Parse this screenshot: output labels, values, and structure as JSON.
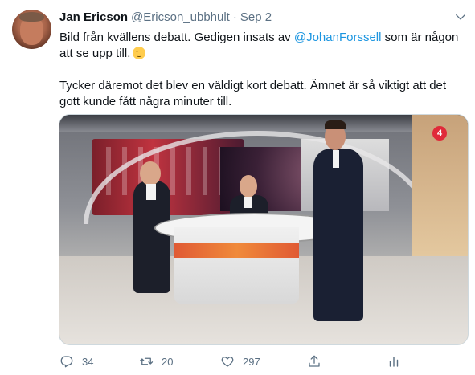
{
  "tweet": {
    "name": "Jan Ericson",
    "handle": "@Ericson_ubbhult",
    "separator": "·",
    "date": "Sep 2",
    "text": {
      "p1_before": "Bild från kvällens debatt. Gedigen insats av ",
      "mention": "@JohanForssell",
      "p1_after": " som är någon att se upp till.",
      "emoji": "winking-face-emoji",
      "p2": "Tycker däremot det blev en väldigt kort debatt. Ämnet är så viktigt att det gott kunde fått några minuter till."
    },
    "media": {
      "channel_logo": "4"
    },
    "actions": {
      "reply_count": "34",
      "retweet_count": "20",
      "like_count": "297"
    }
  },
  "colors": {
    "text": "#0f1419",
    "secondary": "#5b7083",
    "link": "#1b95e0"
  },
  "icons": [
    "chevron-down-icon",
    "reply-icon",
    "retweet-icon",
    "like-icon",
    "share-icon",
    "analytics-icon"
  ]
}
